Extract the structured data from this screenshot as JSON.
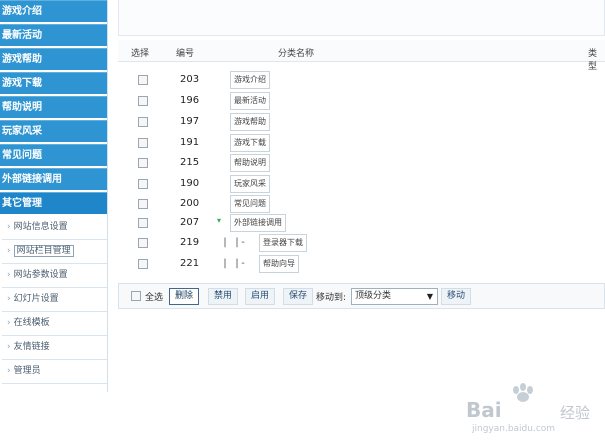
{
  "sidebar": {
    "sections": [
      {
        "label": "游戏介绍"
      },
      {
        "label": "最新活动"
      },
      {
        "label": "游戏帮助"
      },
      {
        "label": "游戏下载"
      },
      {
        "label": "帮助说明"
      },
      {
        "label": "玩家风采"
      },
      {
        "label": "常见问题"
      },
      {
        "label": "外部链接调用"
      },
      {
        "label": "其它管理"
      }
    ],
    "sub_items": [
      {
        "label": "网站信息设置"
      },
      {
        "label": "网站栏目管理"
      },
      {
        "label": "网站参数设置"
      },
      {
        "label": "幻灯片设置"
      },
      {
        "label": "在线模板"
      },
      {
        "label": "友情链接"
      },
      {
        "label": "管理员"
      }
    ]
  },
  "table": {
    "headers": {
      "select": "选择",
      "id": "编号",
      "name": "分类名称",
      "type": "类型"
    },
    "rows": [
      {
        "id": "203",
        "name": "游戏介绍"
      },
      {
        "id": "196",
        "name": "最新活动"
      },
      {
        "id": "197",
        "name": "游戏帮助"
      },
      {
        "id": "191",
        "name": "游戏下载"
      },
      {
        "id": "215",
        "name": "帮助说明"
      },
      {
        "id": "190",
        "name": "玩家风采"
      },
      {
        "id": "200",
        "name": "常见问题"
      },
      {
        "id": "207",
        "name": "外部链接调用"
      },
      {
        "id": "219",
        "name": "登录器下载",
        "tree": "| |-"
      },
      {
        "id": "221",
        "name": "帮助向导",
        "tree": "| |-"
      }
    ]
  },
  "actions": {
    "select_all": "全选",
    "delete": "删除",
    "disable": "禁用",
    "enable": "启用",
    "save": "保存",
    "move_to_label": "移动到:",
    "move_target": "顶级分类",
    "move": "移动"
  },
  "watermark": {
    "brand": "Bai",
    "brand2": "经验",
    "url": "jingyan.baidu.com"
  },
  "colors": {
    "nav_blue": "#2f95d2",
    "accent_green": "#2fb24e"
  }
}
